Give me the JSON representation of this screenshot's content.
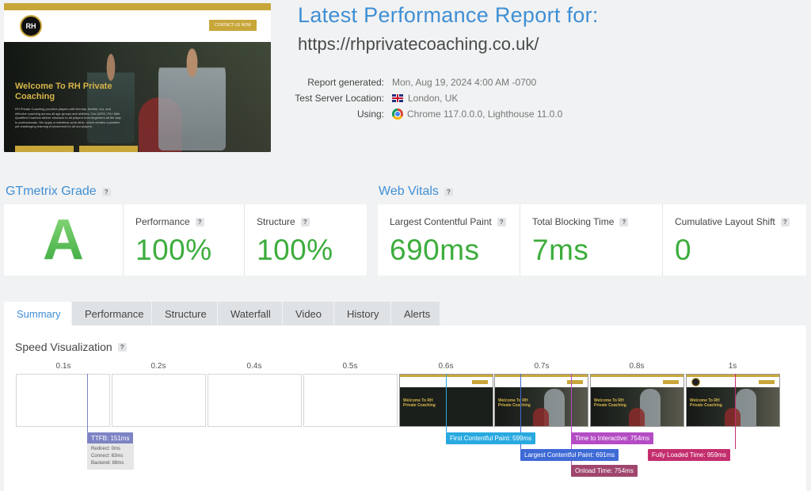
{
  "thumbnail": {
    "logo": "RH",
    "cta": "CONTACT US NOW",
    "hero_title": "Welcome To RH Private Coaching",
    "hero_text": "RH Private Coaching provides players with friendly, flexible, fun, and effective coaching across all age groups and abilities. Our UEFA / FA / Mile Qualified Coaches deliver sessions to all players from beginners all the way to professionals. We apply a relentless work ethic, which creates a positive yet challenging learning environment for all our players."
  },
  "report": {
    "title": "Latest Performance Report for:",
    "url": "https://rhprivatecoaching.co.uk/",
    "generated_label": "Report generated:",
    "generated_value": "Mon, Aug 19, 2024 4:00 AM -0700",
    "location_label": "Test Server Location:",
    "location_value": "London, UK",
    "using_label": "Using:",
    "using_value": "Chrome 117.0.0.0, Lighthouse 11.0.0"
  },
  "grade": {
    "heading": "GTmetrix Grade",
    "letter": "A",
    "performance_label": "Performance",
    "performance_value": "100%",
    "structure_label": "Structure",
    "structure_value": "100%"
  },
  "vitals": {
    "heading": "Web Vitals",
    "lcp_label": "Largest Contentful Paint",
    "lcp_value": "690ms",
    "tbt_label": "Total Blocking Time",
    "tbt_value": "7ms",
    "cls_label": "Cumulative Layout Shift",
    "cls_value": "0"
  },
  "tabs": [
    "Summary",
    "Performance",
    "Structure",
    "Waterfall",
    "Video",
    "History",
    "Alerts"
  ],
  "speed": {
    "title": "Speed Visualization",
    "ticks": [
      "0.1s",
      "0.2s",
      "0.4s",
      "0.5s",
      "0.6s",
      "0.7s",
      "0.8s",
      "1s"
    ],
    "frame_caption": "Welcome To RH Private Coaching",
    "ttfb": "TTFB: 151ms",
    "redirect": "Redirect: 0ms",
    "connect": "Connect: 63ms",
    "backend": "Backend: 88ms",
    "fcp": "First Contentful Paint: 599ms",
    "lcp": "Largest Contentful Paint: 691ms",
    "tti": "Time to Interactive: 754ms",
    "onload": "Onload Time: 754ms",
    "flt": "Fully Loaded Time: 959ms"
  },
  "colors": {
    "accent_blue": "#3f8fd4",
    "grade_green": "#3cad3c",
    "ttfb": "#7d84c4",
    "fcp": "#29a9e0",
    "lcp": "#3e6ad6",
    "tti": "#b44cc4",
    "onload": "#a0466e",
    "flt": "#c42e6e"
  }
}
